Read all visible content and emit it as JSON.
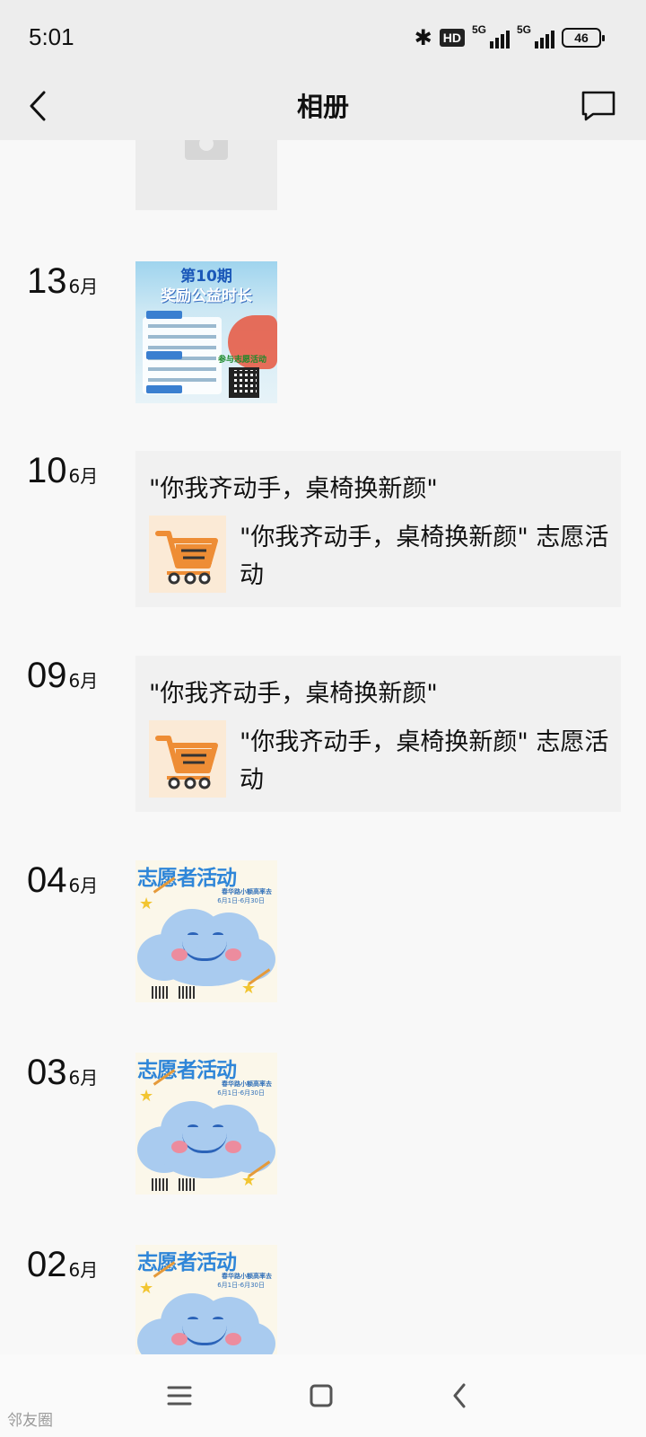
{
  "status_bar": {
    "time": "5:01",
    "hd_badge": "HD",
    "signal_1_label": "5G",
    "signal_2_label": "5G",
    "battery": "46"
  },
  "header": {
    "title": "相册",
    "back_icon": "chevron-left-icon",
    "message_icon": "message-square-icon"
  },
  "entries": [
    {
      "day": "13",
      "month": "6月",
      "type": "image",
      "poster": {
        "title": "第10期",
        "subtitle": "奖励公益时长",
        "note": "参与志愿活动"
      }
    },
    {
      "day": "10",
      "month": "6月",
      "type": "link",
      "text": "\"你我齐动手，桌椅换新颜\"",
      "link_title": "\"你我齐动手，桌椅换新颜\" 志愿活动",
      "link_icon": "shopping-cart-icon"
    },
    {
      "day": "09",
      "month": "6月",
      "type": "link",
      "text": "\"你我齐动手，桌椅换新颜\"",
      "link_title": "\"你我齐动手，桌椅换新颜\" 志愿活动",
      "link_icon": "shopping-cart-icon"
    },
    {
      "day": "04",
      "month": "6月",
      "type": "image",
      "poster": {
        "title": "志愿者活动",
        "subtitle": "春华路小额高率去",
        "dates": "6月1日-6月30日"
      }
    },
    {
      "day": "03",
      "month": "6月",
      "type": "image",
      "poster": {
        "title": "志愿者活动",
        "subtitle": "春华路小额高率去",
        "dates": "6月1日-6月30日"
      }
    },
    {
      "day": "02",
      "month": "6月",
      "type": "image",
      "poster": {
        "title": "志愿者活动",
        "subtitle": "春华路小额高率去",
        "dates": "6月1日-6月30日"
      }
    }
  ],
  "bottom_nav": {
    "menu_icon": "menu-icon",
    "home_icon": "square-home-icon",
    "back_icon": "chevron-left-icon"
  },
  "watermark": "邻友圈"
}
